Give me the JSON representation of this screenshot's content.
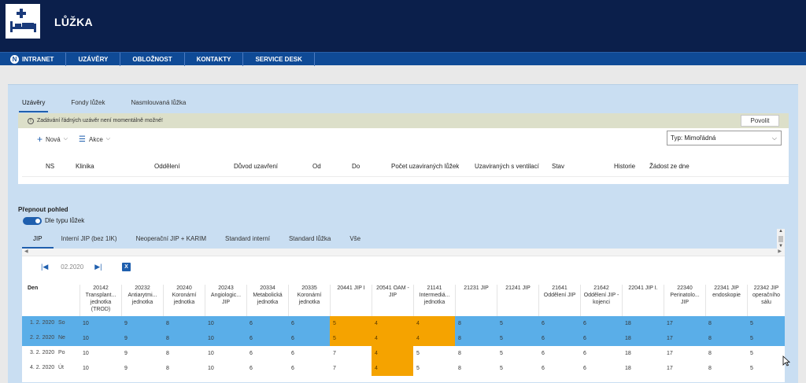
{
  "app": {
    "title": "LŮŽKA",
    "logo_icon": "bed-icon"
  },
  "nav": [
    {
      "label": "INTRANET",
      "icon": "n-logo-icon"
    },
    {
      "label": "UZÁVĚRY"
    },
    {
      "label": "OBLOŽNOST"
    },
    {
      "label": "KONTAKTY"
    },
    {
      "label": "SERVICE DESK"
    }
  ],
  "tabs_top": [
    "Uzávěry",
    "Fondy lůžek",
    "Nasmlouvaná lůžka"
  ],
  "notice": {
    "text": "Zadávání řádných uzávěr není momentálně možné!",
    "button": "Povolit"
  },
  "toolbar": {
    "new_label": "Nová",
    "actions_label": "Akce",
    "type_select": "Typ: Mimořádná"
  },
  "closure_table_headers": [
    "NS",
    "Klinika",
    "Oddělení",
    "Důvod uzavření",
    "Od",
    "Do",
    "Počet uzaviraných lůžek",
    "Uzaviraných s ventilací",
    "Stav",
    "Historie",
    "Žádost ze dne"
  ],
  "switch": {
    "title": "Přepnout pohled",
    "toggle_label": "Dle typu lůžek"
  },
  "tabs_bottom": [
    "JIP",
    "Interní JIP (bez 1IK)",
    "Neoperační JIP + KARIM",
    "Standard interní",
    "Standard lůžka",
    "Vše"
  ],
  "grid": {
    "month": "02.2020",
    "day_header": "Den",
    "columns": [
      "20142 Transplant... jednotka (TROD)",
      "20232 Antiarytmi... jednotka",
      "20240 Koronární jednotka",
      "20243 Angiologic... JIP",
      "20334 Metabolická jednotka",
      "20335 Koronární jednotka",
      "20441 JIP I",
      "20541 OAM - JIP",
      "21141 Intermediá... jednotka",
      "21231 JIP",
      "21241 JIP",
      "21641 Oddělení JIP",
      "21642 Oddělení JIP - kojenci",
      "22041 JIP I.",
      "22340 Perinatolo... JIP",
      "22341 JIP endoskopie",
      "22342 JIP operačního sálu"
    ],
    "rows": [
      {
        "date": "1. 2. 2020",
        "dow": "So",
        "selected": true,
        "values": [
          "10",
          "9",
          "8",
          "10",
          "6",
          "6",
          "5",
          "4",
          "4",
          "8",
          "5",
          "6",
          "6",
          "18",
          "17",
          "8",
          "5"
        ]
      },
      {
        "date": "2. 2. 2020",
        "dow": "Ne",
        "selected": true,
        "values": [
          "10",
          "9",
          "8",
          "10",
          "6",
          "6",
          "5",
          "4",
          "4",
          "8",
          "5",
          "6",
          "6",
          "18",
          "17",
          "8",
          "5"
        ]
      },
      {
        "date": "3. 2. 2020",
        "dow": "Po",
        "selected": false,
        "values": [
          "10",
          "9",
          "8",
          "10",
          "6",
          "6",
          "7",
          "4",
          "5",
          "8",
          "5",
          "6",
          "6",
          "18",
          "17",
          "8",
          "5"
        ]
      },
      {
        "date": "4. 2. 2020",
        "dow": "Út",
        "selected": false,
        "values": [
          "10",
          "9",
          "8",
          "10",
          "6",
          "6",
          "7",
          "4",
          "5",
          "8",
          "5",
          "6",
          "6",
          "18",
          "17",
          "8",
          "5"
        ]
      }
    ],
    "highlight_color": "#f5a300",
    "selected_row_color": "#5aaee8"
  }
}
